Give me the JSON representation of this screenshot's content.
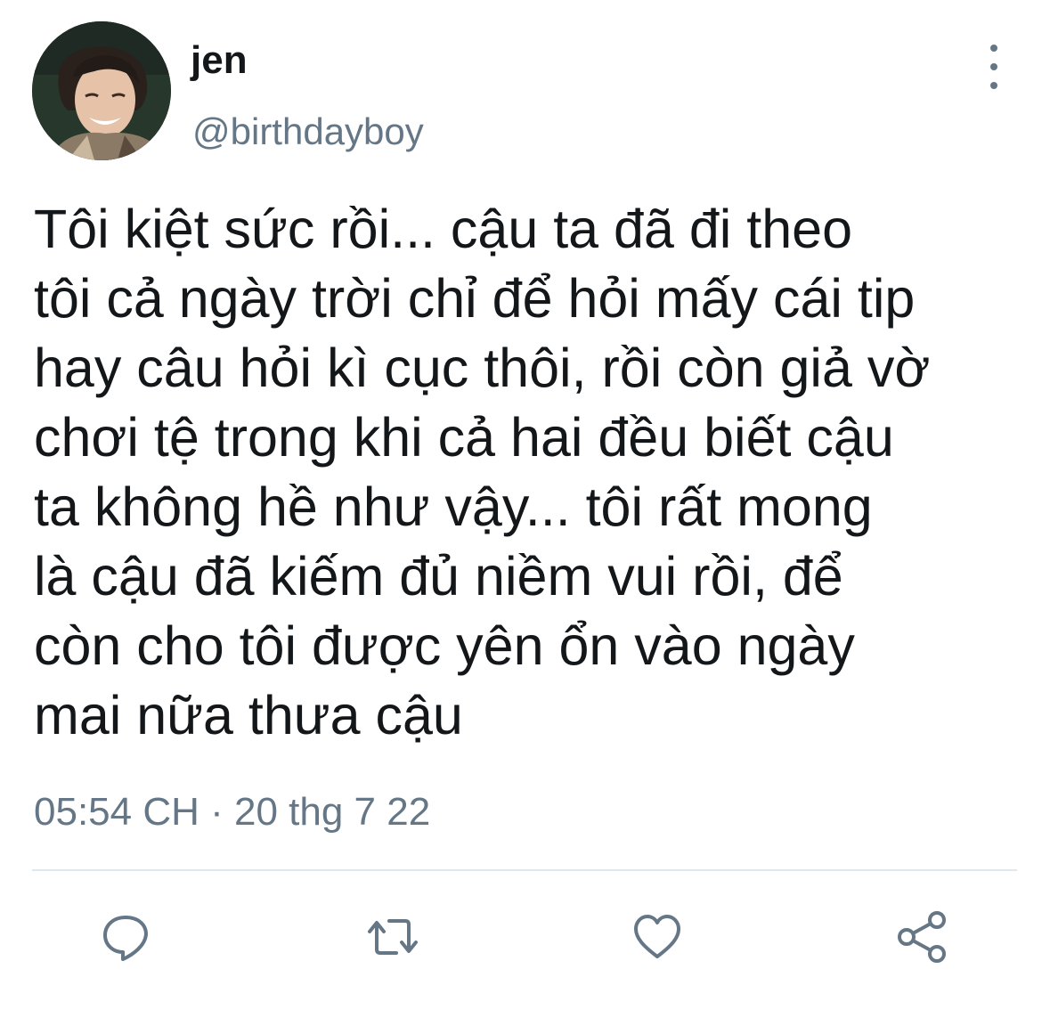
{
  "author": {
    "display_name": "jen",
    "handle": "@birthdayboy",
    "avatar": "profile-photo"
  },
  "tweet": {
    "text": "Tôi kiệt sức rồi... cậu ta đã đi theo\ntôi cả ngày trời chỉ để hỏi mấy cái tip\nhay câu hỏi kì cục thôi, rồi còn giả vờ\nchơi tệ trong khi cả hai đều biết cậu\nta không hề như vậy... tôi rất mong\nlà cậu đã kiếm đủ niềm vui rồi, để\ncòn cho tôi được yên ổn vào ngày\nmai nữa thưa cậu",
    "timestamp": "05:54 CH · 20 thg 7 22"
  },
  "actions": {
    "reply_icon": "speech-bubble",
    "retweet_icon": "retweet-arrows",
    "like_icon": "heart",
    "share_icon": "share-nodes",
    "more_icon": "vertical-dots"
  },
  "colors": {
    "text": "#14171a",
    "secondary": "#657786",
    "divider": "#e1e8ed"
  }
}
